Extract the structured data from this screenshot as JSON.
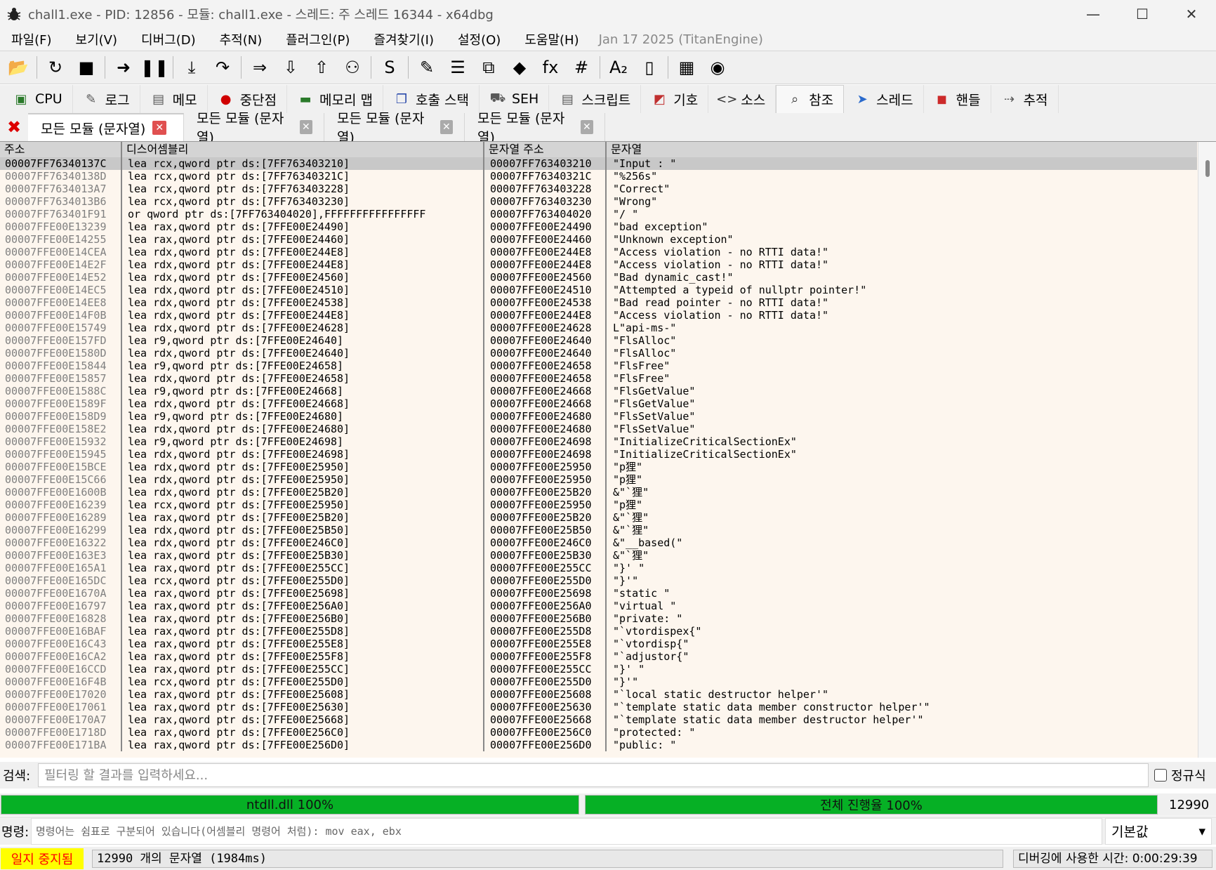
{
  "window": {
    "title": "chall1.exe - PID: 12856 - 모듈: chall1.exe - 스레드: 주 스레드 16344 - x64dbg",
    "minimize": "—",
    "maximize": "☐",
    "close": "✕"
  },
  "menu": {
    "items": [
      "파일(F)",
      "보기(V)",
      "디버그(D)",
      "추적(N)",
      "플러그인(P)",
      "즐겨찾기(I)",
      "설정(O)",
      "도움말(H)"
    ],
    "build_info": "Jan 17 2025 (TitanEngine)"
  },
  "toolbar": {
    "buttons": [
      {
        "icon": "open-folder-icon",
        "glyph": "📂"
      },
      {
        "icon": "restart-icon",
        "glyph": "↻"
      },
      {
        "icon": "stop-icon",
        "glyph": "■"
      },
      {
        "icon": "run-icon",
        "glyph": "➜"
      },
      {
        "icon": "pause-icon",
        "glyph": "❚❚"
      },
      {
        "icon": "step-into-icon",
        "glyph": "⤓"
      },
      {
        "icon": "step-over-icon",
        "glyph": "↷"
      },
      {
        "icon": "trace-into-icon",
        "glyph": "⇒"
      },
      {
        "icon": "trace-over-icon",
        "glyph": "⇩"
      },
      {
        "icon": "execute-till-return-icon",
        "glyph": "⇧"
      },
      {
        "icon": "run-to-user-code-icon",
        "glyph": "⚇"
      },
      {
        "icon": "scylla-icon",
        "glyph": "S"
      },
      {
        "icon": "patch-icon",
        "glyph": "✎"
      },
      {
        "icon": "comments-icon",
        "glyph": "☰"
      },
      {
        "icon": "labels-icon",
        "glyph": "⧉"
      },
      {
        "icon": "bookmarks-icon",
        "glyph": "◆"
      },
      {
        "icon": "functions-icon",
        "glyph": "fx"
      },
      {
        "icon": "variables-icon",
        "glyph": "#"
      },
      {
        "icon": "font-icon",
        "glyph": "A₂"
      },
      {
        "icon": "device-icon",
        "glyph": "▯"
      },
      {
        "icon": "calculator-icon",
        "glyph": "▦"
      },
      {
        "icon": "globe-icon",
        "glyph": "◉"
      }
    ]
  },
  "main_tabs": [
    {
      "name": "tab-cpu",
      "icon": "cpu-icon",
      "glyph": "▣",
      "color": "#2a7a2a",
      "label": "CPU"
    },
    {
      "name": "tab-log",
      "icon": "log-icon",
      "glyph": "✎",
      "color": "#5a5a5a",
      "label": "로그"
    },
    {
      "name": "tab-notes",
      "icon": "notes-icon",
      "glyph": "▤",
      "color": "#5a5a5a",
      "label": "메모"
    },
    {
      "name": "tab-breakpoints",
      "icon": "breakpoint-icon",
      "glyph": "●",
      "color": "#d00000",
      "label": "중단점"
    },
    {
      "name": "tab-memory-map",
      "icon": "memory-map-icon",
      "glyph": "▬",
      "color": "#2a7a2a",
      "label": "메모리 맵"
    },
    {
      "name": "tab-call-stack",
      "icon": "call-stack-icon",
      "glyph": "❐",
      "color": "#2a4aaa",
      "label": "호출 스택"
    },
    {
      "name": "tab-seh",
      "icon": "seh-icon",
      "glyph": "⛟",
      "color": "#5a5a5a",
      "label": "SEH"
    },
    {
      "name": "tab-script",
      "icon": "script-icon",
      "glyph": "▤",
      "color": "#5a5a5a",
      "label": "스크립트"
    },
    {
      "name": "tab-symbols",
      "icon": "symbols-icon",
      "glyph": "◩",
      "color": "#c03030",
      "label": "기호"
    },
    {
      "name": "tab-source",
      "icon": "source-icon",
      "glyph": "<>",
      "color": "#333333",
      "label": "소스"
    },
    {
      "name": "tab-references",
      "icon": "search-icon",
      "glyph": "⌕",
      "color": "#333333",
      "label": "참조"
    },
    {
      "name": "tab-threads",
      "icon": "threads-icon",
      "glyph": "➤",
      "color": "#2a6acc",
      "label": "스레드"
    },
    {
      "name": "tab-handles",
      "icon": "handles-icon",
      "glyph": "◼",
      "color": "#cc2a2a",
      "label": "핸들"
    },
    {
      "name": "tab-trace",
      "icon": "trace-icon",
      "glyph": "⇢",
      "color": "#5a5a5a",
      "label": "추적"
    }
  ],
  "sub_tabs": {
    "close_all": "✖",
    "tabs": [
      "모든 모듈 (문자열)",
      "모든 모듈 (문자열)",
      "모든 모듈 (문자열)",
      "모든 모듈 (문자열)"
    ],
    "close_glyph": "✕"
  },
  "table": {
    "columns": [
      "주소",
      "디스어셈블리",
      "문자열 주소",
      "문자열"
    ],
    "rows": [
      [
        "00007FF76340137C",
        "lea rcx,qword ptr ds:[7FF763403210]",
        "00007FF763403210",
        "\"Input : \""
      ],
      [
        "00007FF76340138D",
        "lea rcx,qword ptr ds:[7FF76340321C]",
        "00007FF76340321C",
        "\"%256s\""
      ],
      [
        "00007FF7634013A7",
        "lea rcx,qword ptr ds:[7FF763403228]",
        "00007FF763403228",
        "\"Correct\""
      ],
      [
        "00007FF7634013B6",
        "lea rcx,qword ptr ds:[7FF763403230]",
        "00007FF763403230",
        "\"Wrong\""
      ],
      [
        "00007FF763401F91",
        "or qword ptr ds:[7FF763404020],FFFFFFFFFFFFFFFF",
        "00007FF763404020",
        "\"/ \""
      ],
      [
        "00007FFE00E13239",
        "lea rax,qword ptr ds:[7FFE00E24490]",
        "00007FFE00E24490",
        "\"bad exception\""
      ],
      [
        "00007FFE00E14255",
        "lea rax,qword ptr ds:[7FFE00E24460]",
        "00007FFE00E24460",
        "\"Unknown exception\""
      ],
      [
        "00007FFE00E14CEA",
        "lea rdx,qword ptr ds:[7FFE00E244E8]",
        "00007FFE00E244E8",
        "\"Access violation - no RTTI data!\""
      ],
      [
        "00007FFE00E14E2F",
        "lea rdx,qword ptr ds:[7FFE00E244E8]",
        "00007FFE00E244E8",
        "\"Access violation - no RTTI data!\""
      ],
      [
        "00007FFE00E14E52",
        "lea rdx,qword ptr ds:[7FFE00E24560]",
        "00007FFE00E24560",
        "\"Bad dynamic_cast!\""
      ],
      [
        "00007FFE00E14EC5",
        "lea rdx,qword ptr ds:[7FFE00E24510]",
        "00007FFE00E24510",
        "\"Attempted a typeid of nullptr pointer!\""
      ],
      [
        "00007FFE00E14EE8",
        "lea rdx,qword ptr ds:[7FFE00E24538]",
        "00007FFE00E24538",
        "\"Bad read pointer - no RTTI data!\""
      ],
      [
        "00007FFE00E14F0B",
        "lea rdx,qword ptr ds:[7FFE00E244E8]",
        "00007FFE00E244E8",
        "\"Access violation - no RTTI data!\""
      ],
      [
        "00007FFE00E15749",
        "lea rdx,qword ptr ds:[7FFE00E24628]",
        "00007FFE00E24628",
        "L\"api-ms-\""
      ],
      [
        "00007FFE00E157FD",
        "lea r9,qword ptr ds:[7FFE00E24640]",
        "00007FFE00E24640",
        "\"FlsAlloc\""
      ],
      [
        "00007FFE00E1580D",
        "lea rdx,qword ptr ds:[7FFE00E24640]",
        "00007FFE00E24640",
        "\"FlsAlloc\""
      ],
      [
        "00007FFE00E15844",
        "lea r9,qword ptr ds:[7FFE00E24658]",
        "00007FFE00E24658",
        "\"FlsFree\""
      ],
      [
        "00007FFE00E15857",
        "lea rdx,qword ptr ds:[7FFE00E24658]",
        "00007FFE00E24658",
        "\"FlsFree\""
      ],
      [
        "00007FFE00E1588C",
        "lea r9,qword ptr ds:[7FFE00E24668]",
        "00007FFE00E24668",
        "\"FlsGetValue\""
      ],
      [
        "00007FFE00E1589F",
        "lea rdx,qword ptr ds:[7FFE00E24668]",
        "00007FFE00E24668",
        "\"FlsGetValue\""
      ],
      [
        "00007FFE00E158D9",
        "lea r9,qword ptr ds:[7FFE00E24680]",
        "00007FFE00E24680",
        "\"FlsSetValue\""
      ],
      [
        "00007FFE00E158E2",
        "lea rdx,qword ptr ds:[7FFE00E24680]",
        "00007FFE00E24680",
        "\"FlsSetValue\""
      ],
      [
        "00007FFE00E15932",
        "lea r9,qword ptr ds:[7FFE00E24698]",
        "00007FFE00E24698",
        "\"InitializeCriticalSectionEx\""
      ],
      [
        "00007FFE00E15945",
        "lea rdx,qword ptr ds:[7FFE00E24698]",
        "00007FFE00E24698",
        "\"InitializeCriticalSectionEx\""
      ],
      [
        "00007FFE00E15BCE",
        "lea rdx,qword ptr ds:[7FFE00E25950]",
        "00007FFE00E25950",
        "\"p狸\""
      ],
      [
        "00007FFE00E15C66",
        "lea rdx,qword ptr ds:[7FFE00E25950]",
        "00007FFE00E25950",
        "\"p狸\""
      ],
      [
        "00007FFE00E1600B",
        "lea rdx,qword ptr ds:[7FFE00E25B20]",
        "00007FFE00E25B20",
        "&\"`狸\""
      ],
      [
        "00007FFE00E16239",
        "lea rcx,qword ptr ds:[7FFE00E25950]",
        "00007FFE00E25950",
        "\"p狸\""
      ],
      [
        "00007FFE00E16289",
        "lea rax,qword ptr ds:[7FFE00E25B20]",
        "00007FFE00E25B20",
        "&\"`狸\""
      ],
      [
        "00007FFE00E16299",
        "lea rdx,qword ptr ds:[7FFE00E25B50]",
        "00007FFE00E25B50",
        "&\"`狸\""
      ],
      [
        "00007FFE00E16322",
        "lea rdx,qword ptr ds:[7FFE00E246C0]",
        "00007FFE00E246C0",
        "&\"__based(\""
      ],
      [
        "00007FFE00E163E3",
        "lea rax,qword ptr ds:[7FFE00E25B30]",
        "00007FFE00E25B30",
        "&\"`狸\""
      ],
      [
        "00007FFE00E165A1",
        "lea rax,qword ptr ds:[7FFE00E255CC]",
        "00007FFE00E255CC",
        "\"}' \""
      ],
      [
        "00007FFE00E165DC",
        "lea rcx,qword ptr ds:[7FFE00E255D0]",
        "00007FFE00E255D0",
        "\"}'\""
      ],
      [
        "00007FFE00E1670A",
        "lea rax,qword ptr ds:[7FFE00E25698]",
        "00007FFE00E25698",
        "\"static \""
      ],
      [
        "00007FFE00E16797",
        "lea rax,qword ptr ds:[7FFE00E256A0]",
        "00007FFE00E256A0",
        "\"virtual \""
      ],
      [
        "00007FFE00E16828",
        "lea rax,qword ptr ds:[7FFE00E256B0]",
        "00007FFE00E256B0",
        "\"private: \""
      ],
      [
        "00007FFE00E16BAF",
        "lea rax,qword ptr ds:[7FFE00E255D8]",
        "00007FFE00E255D8",
        "\"`vtordispex{\""
      ],
      [
        "00007FFE00E16C43",
        "lea rax,qword ptr ds:[7FFE00E255E8]",
        "00007FFE00E255E8",
        "\"`vtordisp{\""
      ],
      [
        "00007FFE00E16CA2",
        "lea rax,qword ptr ds:[7FFE00E255F8]",
        "00007FFE00E255F8",
        "\"`adjustor{\""
      ],
      [
        "00007FFE00E16CCD",
        "lea rax,qword ptr ds:[7FFE00E255CC]",
        "00007FFE00E255CC",
        "\"}' \""
      ],
      [
        "00007FFE00E16F4B",
        "lea rcx,qword ptr ds:[7FFE00E255D0]",
        "00007FFE00E255D0",
        "\"}'\""
      ],
      [
        "00007FFE00E17020",
        "lea rax,qword ptr ds:[7FFE00E25608]",
        "00007FFE00E25608",
        "\"`local static destructor helper'\""
      ],
      [
        "00007FFE00E17061",
        "lea rax,qword ptr ds:[7FFE00E25630]",
        "00007FFE00E25630",
        "\"`template static data member constructor helper'\""
      ],
      [
        "00007FFE00E170A7",
        "lea rax,qword ptr ds:[7FFE00E25668]",
        "00007FFE00E25668",
        "\"`template static data member destructor helper'\""
      ],
      [
        "00007FFE00E1718D",
        "lea rax,qword ptr ds:[7FFE00E256C0]",
        "00007FFE00E256C0",
        "\"protected: \""
      ],
      [
        "00007FFE00E171BA",
        "lea rax,qword ptr ds:[7FFE00E256D0]",
        "00007FFE00E256D0",
        "\"public: \""
      ]
    ]
  },
  "search": {
    "label": "검색:",
    "placeholder": "필터링 할 결과를 입력하세요...",
    "regex_label": "정규식",
    "regex_checked": false
  },
  "progress": {
    "left": {
      "label": "ntdll.dll 100%",
      "value": 1.0
    },
    "right": {
      "label": "전체 진행율 100%",
      "value": 1.0
    },
    "count": "12990",
    "bar_color": "#06b025"
  },
  "command": {
    "label": "명령:",
    "placeholder": "명령어는 쉼표로 구분되어 있습니다(어셈블리 명령어 처럼): mov eax, ebx",
    "mode": "기본값",
    "mode_arrow": "▾"
  },
  "status": {
    "state": "일지 중지됨",
    "state_bg": "#ffff00",
    "state_fg": "#ff0000",
    "message": "12990 개의 문자열 (1984ms)",
    "debug_time": "디버깅에 사용한 시간: 0:00:29:39"
  }
}
